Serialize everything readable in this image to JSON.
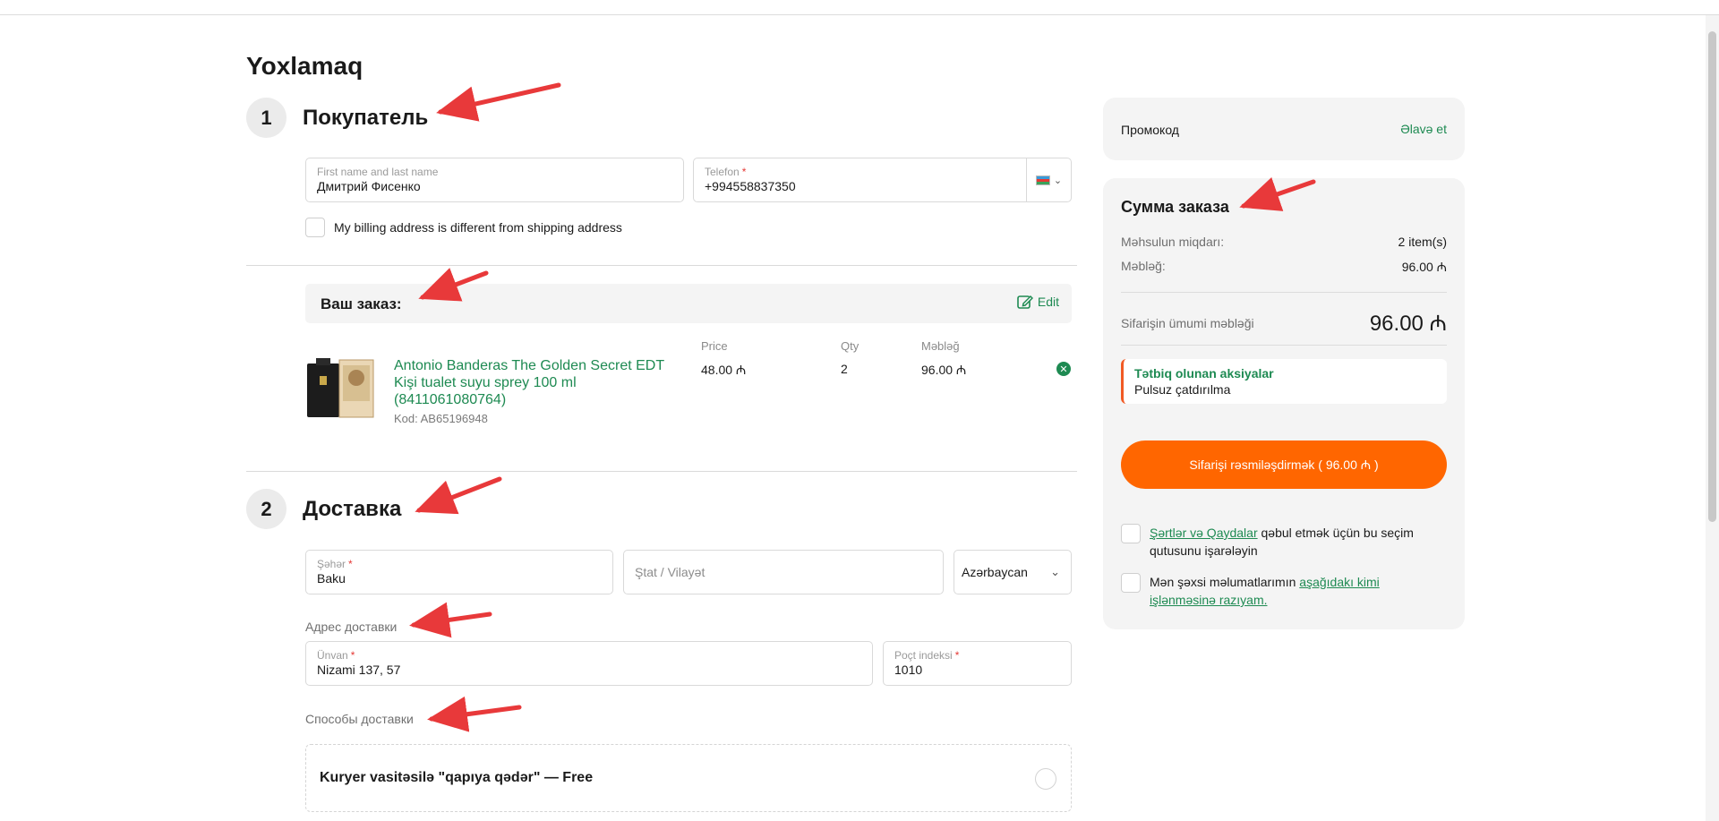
{
  "page": {
    "title": "Yoxlamaq"
  },
  "step1": {
    "number": "1",
    "title": "Покупатель"
  },
  "buyer": {
    "name_label": "First name and last name",
    "name_value": "Дмитрий Фисенко",
    "phone_label": "Telefon",
    "phone_required": "*",
    "phone_value": "+994558837350",
    "billing_checkbox_label": "My billing address is different from shipping address"
  },
  "order": {
    "title": "Ваш заказ:",
    "edit_label": "Edit",
    "columns": {
      "price": "Price",
      "qty": "Qty",
      "amount": "Məbləğ"
    },
    "item": {
      "name": "Antonio Banderas The Golden Secret EDT Kişi tualet suyu sprey 100 ml (8411061080764)",
      "code": "Kod: AB65196948",
      "price": "48.00 ₼",
      "qty": "2",
      "amount": "96.00 ₼"
    }
  },
  "step2": {
    "number": "2",
    "title": "Доставка"
  },
  "delivery": {
    "city_label": "Şəhər",
    "city_required": "*",
    "city_value": "Baku",
    "state_placeholder": "Ştat / Vilayət",
    "country_value": "Azərbaycan",
    "address_section": "Адрес доставки",
    "address_label": "Ünvan",
    "address_required": "*",
    "address_value": "Nizami 137, 57",
    "postcode_label": "Poçt indeksi",
    "postcode_required": "*",
    "postcode_value": "1010",
    "methods_section": "Способы доставки",
    "method_option": "Kuryer vasitəsilə \"qapıya qədər\" — Free"
  },
  "promo": {
    "label": "Промокод",
    "action": "Əlavə et"
  },
  "summary": {
    "title": "Сумма заказа",
    "qty_label": "Məhsulun miqdarı:",
    "qty_value": "2 item(s)",
    "amount_label": "Məbləğ:",
    "amount_value": "96.00 ₼",
    "total_label": "Sifarişin ümumi məbləği",
    "total_value": "96.00 ₼",
    "promo_title": "Tətbiq olunan aksiyalar",
    "promo_value": "Pulsuz çatdırılma",
    "order_button": "Sifarişi rəsmiləşdirmək ( 96.00 ₼ )",
    "terms_link": "Şərtlər və Qaydalar",
    "terms_text": " qəbul etmək üçün bu seçim qutusunu işarələyin",
    "privacy_text": "Mən şəxsi məlumatlarımın ",
    "privacy_link": "aşağıdakı kimi işlənməsinə razıyam."
  },
  "colors": {
    "accent": "#ff6600",
    "link": "#1e8a52",
    "arrow": "#e8393a"
  }
}
